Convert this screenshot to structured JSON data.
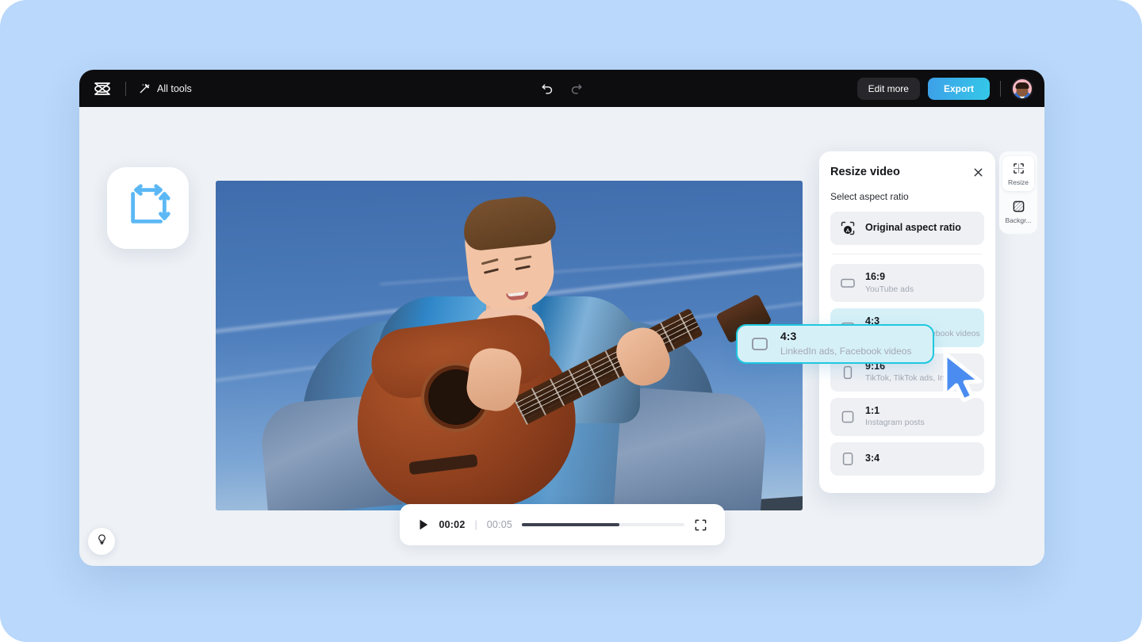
{
  "app": {
    "brand": "CapCut",
    "brand_icon": "capcut-logo-icon"
  },
  "topbar": {
    "all_tools_label": "All tools",
    "all_tools_icon": "magic-wand-icon",
    "undo_icon": "undo-arrow-icon",
    "redo_icon": "redo-arrow-icon",
    "edit_more_label": "Edit more",
    "export_label": "Export",
    "avatar_name": "user-avatar",
    "export_gradient_from": "#3da0e8",
    "export_gradient_to": "#34c8e8"
  },
  "workspace": {
    "tool_tile_icon": "resize-arrows-icon",
    "hint_icon": "lightbulb-icon",
    "background_color": "#eef1f5"
  },
  "player": {
    "play_icon": "play-icon",
    "current_time": "00:02",
    "time_separator": "|",
    "total_time": "00:05",
    "progress_percent": 60,
    "fullscreen_icon": "fullscreen-icon"
  },
  "panel": {
    "title": "Resize video",
    "close_icon": "close-icon",
    "subtitle": "Select aspect ratio",
    "original": {
      "label": "Original aspect ratio",
      "icon": "original-ratio-icon"
    },
    "ratios": [
      {
        "name": "16:9",
        "desc": "YouTube ads",
        "icon": "ratio-16-9-icon",
        "highlight": false
      },
      {
        "name": "4:3",
        "desc": "LinkedIn ads, Facebook videos",
        "icon": "ratio-4-3-icon",
        "highlight": true
      },
      {
        "name": "9:16",
        "desc": "TikTok, TikTok ads, Instagram...",
        "icon": "ratio-9-16-icon",
        "highlight": false
      },
      {
        "name": "1:1",
        "desc": "Instagram posts",
        "icon": "ratio-1-1-icon",
        "highlight": false
      },
      {
        "name": "3:4",
        "desc": "",
        "icon": "ratio-3-4-icon",
        "highlight": false
      }
    ],
    "highlight_color": "#d6f0f7"
  },
  "callout": {
    "name": "4:3",
    "desc": "LinkedIn ads, Facebook videos",
    "icon": "ratio-4-3-icon",
    "border_color": "#1ec8e0",
    "cursor_icon": "mouse-pointer-icon",
    "cursor_color": "#4a8cf0"
  },
  "rail": {
    "items": [
      {
        "label": "Resize",
        "icon": "resize-icon",
        "active": true
      },
      {
        "label": "Backgr...",
        "icon": "background-icon",
        "active": false
      }
    ]
  },
  "video": {
    "description": "Woman with long brown hair in blue plaid shirt playing an acoustic guitar against a blue sky with contrails",
    "sky_color": "#4a78b8"
  },
  "page": {
    "background_color": "#b9d8fb"
  }
}
